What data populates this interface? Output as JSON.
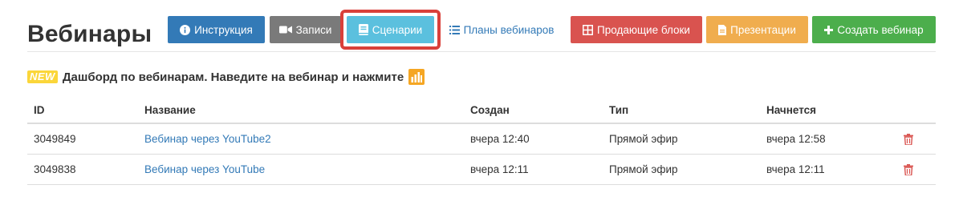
{
  "page": {
    "title": "Вебинары"
  },
  "toolbar": {
    "instruction_label": "Инструкция",
    "records_label": "Записи",
    "scenarios_label": "Сценарии",
    "plans_label": "Планы вебинаров",
    "selling_blocks_label": "Продающие блоки",
    "presentations_label": "Презентации",
    "create_label": "Создать вебинар"
  },
  "notice": {
    "badge": "NEW",
    "text": "Дашборд по вебинарам. Наведите на вебинар и нажмите"
  },
  "table": {
    "columns": {
      "id": "ID",
      "name": "Название",
      "created": "Создан",
      "type": "Тип",
      "starts": "Начнется"
    },
    "rows": [
      {
        "id": "3049849",
        "name": "Вебинар через YouTube2",
        "created": "вчера 12:40",
        "type": "Прямой эфир",
        "starts": "вчера 12:58"
      },
      {
        "id": "3049838",
        "name": "Вебинар через YouTube",
        "created": "вчера 12:11",
        "type": "Прямой эфир",
        "starts": "вчера 12:11"
      }
    ]
  },
  "colors": {
    "primary": "#337ab7",
    "default_gray": "#7a7a7a",
    "info": "#5bc0de",
    "danger": "#d9534f",
    "warning": "#f0ad4e",
    "success": "#4cae4c",
    "highlight_frame": "#d9403a",
    "new_badge": "#fbd63a"
  },
  "icons": {
    "instruction": "info-circle-icon",
    "records": "video-camera-icon",
    "scenarios": "book-icon",
    "plans": "list-icon",
    "selling_blocks": "grid-icon",
    "presentations": "file-icon",
    "create": "plus-icon",
    "dashboard": "bar-chart-icon",
    "delete": "trash-icon"
  }
}
